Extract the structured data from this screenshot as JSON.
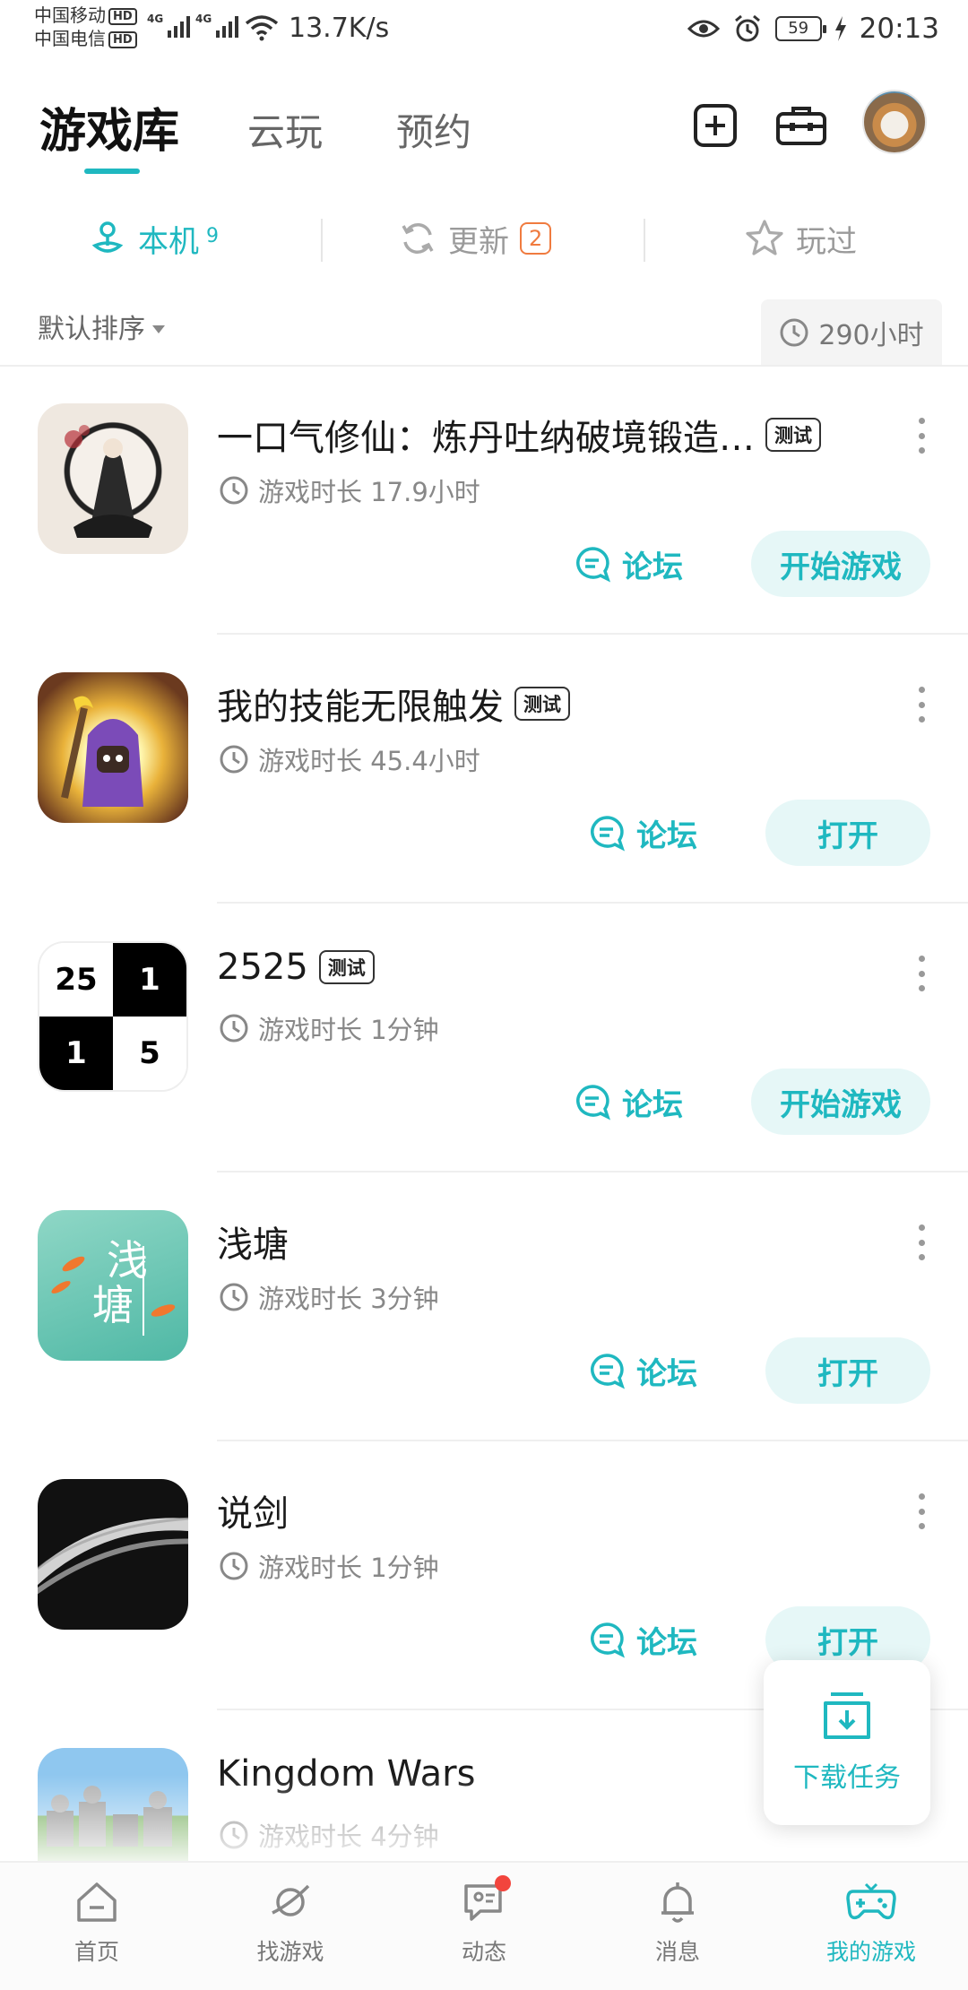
{
  "status_bar": {
    "carrier1": "中国移动",
    "carrier2": "中国电信",
    "hd": "HD",
    "net": "4G",
    "speed": "13.7K/s",
    "battery": "59",
    "time": "20:13"
  },
  "top_tabs": {
    "library": "游戏库",
    "cloud": "云玩",
    "reserve": "预约"
  },
  "filters": {
    "local_label": "本机",
    "local_count": "9",
    "update_label": "更新",
    "update_count": "2",
    "played_label": "玩过"
  },
  "sort": {
    "label": "默认排序",
    "total_time": "290小时"
  },
  "games": [
    {
      "name": "一口气修仙：炼丹吐纳破境锻造…",
      "tag": "测试",
      "time": "游戏时长 17.9小时",
      "forum": "论坛",
      "action": "开始游戏"
    },
    {
      "name": "我的技能无限触发",
      "tag": "测试",
      "time": "游戏时长 45.4小时",
      "forum": "论坛",
      "action": "打开"
    },
    {
      "name": "2525",
      "tag": "测试",
      "time": "游戏时长 1分钟",
      "forum": "论坛",
      "action": "开始游戏",
      "icon_cells": [
        "25",
        "1",
        "1",
        "5"
      ]
    },
    {
      "name": "浅塘",
      "tag": "",
      "time": "游戏时长 3分钟",
      "forum": "论坛",
      "action": "打开",
      "icon_text1": "浅",
      "icon_text2": "塘"
    },
    {
      "name": "说剑",
      "tag": "",
      "time": "游戏时长 1分钟",
      "forum": "论坛",
      "action": "打开"
    },
    {
      "name": "Kingdom Wars",
      "tag": "",
      "time": "游戏时长 4分钟",
      "forum": "",
      "action": ""
    }
  ],
  "download_float": {
    "label": "下载任务"
  },
  "bottom_nav": {
    "home": "首页",
    "find": "找游戏",
    "feed": "动态",
    "messages": "消息",
    "mygames": "我的游戏"
  },
  "colors": {
    "accent": "#1fb8c0",
    "badge": "#f07b3f",
    "notify": "#f2453d"
  }
}
